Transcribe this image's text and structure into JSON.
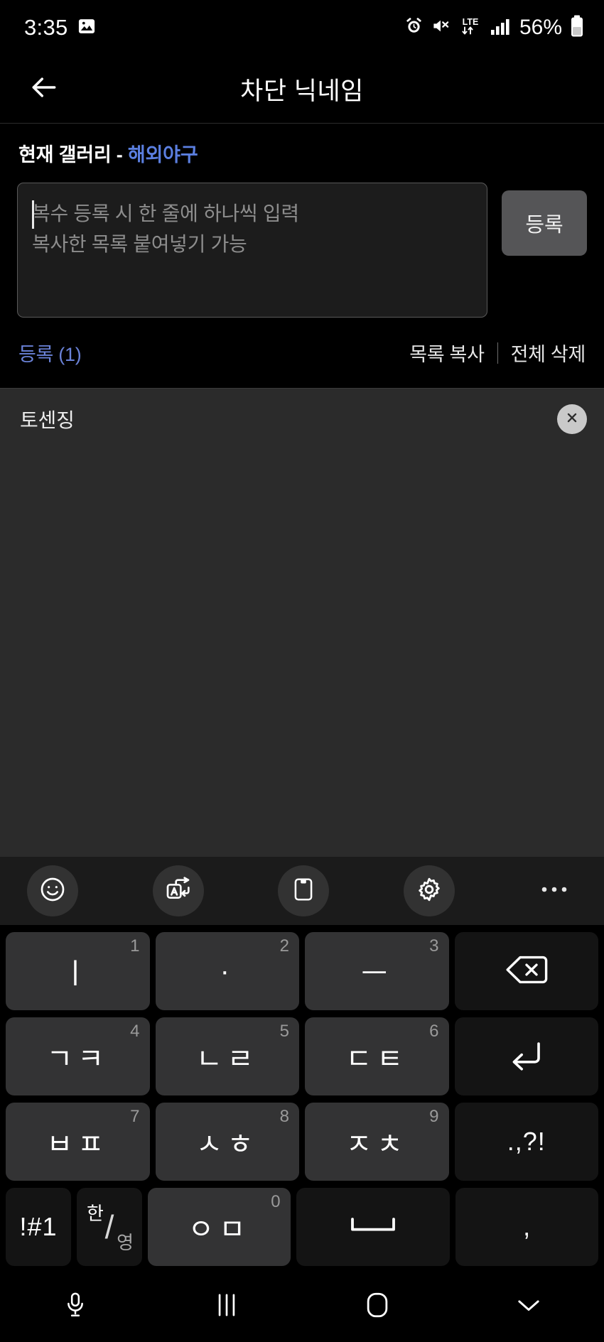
{
  "status_bar": {
    "time": "3:35",
    "battery_percent": "56%",
    "network_label": "LTE",
    "icons": [
      "gallery-image-icon",
      "alarm-icon",
      "mute-icon",
      "lte-data-icon",
      "signal-bars-icon",
      "battery-icon"
    ]
  },
  "app_bar": {
    "title": "차단 닉네임",
    "back_icon": "back-arrow-icon"
  },
  "form": {
    "gallery_prefix": "현재 갤러리 - ",
    "gallery_name": "해외야구",
    "gallery_name_color": "#5b7fe0",
    "textarea_value": "",
    "textarea_placeholder": "복수 등록 시 한 줄에 하나씩 입력\n복사한 목록 붙여넣기 가능",
    "submit_label": "등록"
  },
  "meta": {
    "count_label": "등록 (1)",
    "count_color": "#6a82d8",
    "copy_list_label": "목록 복사",
    "delete_all_label": "전체 삭제"
  },
  "blocked_list": {
    "items": [
      {
        "nickname": "토센징",
        "remove_icon": "close-circle-icon"
      }
    ]
  },
  "keyboard": {
    "toolbar": [
      {
        "name": "emoji-icon"
      },
      {
        "name": "translate-icon"
      },
      {
        "name": "clipboard-icon"
      },
      {
        "name": "settings-gear-icon"
      },
      {
        "name": "more-options-icon"
      }
    ],
    "rows": [
      [
        {
          "glyph": "ㅣ",
          "num": "1",
          "style": "normal"
        },
        {
          "glyph": "·",
          "num": "2",
          "style": "normal"
        },
        {
          "glyph": "ㅡ",
          "num": "3",
          "style": "normal"
        },
        {
          "glyph": "",
          "num": "",
          "style": "dark",
          "icon": "backspace-icon"
        }
      ],
      [
        {
          "glyph": "ㄱㅋ",
          "num": "4",
          "style": "normal"
        },
        {
          "glyph": "ㄴㄹ",
          "num": "5",
          "style": "normal"
        },
        {
          "glyph": "ㄷㅌ",
          "num": "6",
          "style": "normal"
        },
        {
          "glyph": "",
          "num": "",
          "style": "dark",
          "icon": "enter-icon"
        }
      ],
      [
        {
          "glyph": "ㅂㅍ",
          "num": "7",
          "style": "normal"
        },
        {
          "glyph": "ㅅㅎ",
          "num": "8",
          "style": "normal"
        },
        {
          "glyph": "ㅈㅊ",
          "num": "9",
          "style": "normal"
        },
        {
          "glyph": ".,?!",
          "num": "",
          "style": "dark"
        }
      ],
      [
        {
          "glyph": "!#1",
          "num": "",
          "style": "dark",
          "size": "narrow"
        },
        {
          "glyph": "한/영",
          "num": "",
          "style": "dark",
          "size": "narrow",
          "icon": "han-yeong-icon"
        },
        {
          "glyph": "ㅇㅁ",
          "num": "0",
          "style": "normal"
        },
        {
          "glyph": "",
          "num": "",
          "style": "dark",
          "icon": "space-icon"
        },
        {
          "glyph": ",",
          "num": "",
          "style": "dark"
        }
      ]
    ],
    "han_top": "한",
    "han_bottom": "영"
  },
  "nav_bar": {
    "buttons": [
      "microphone-icon",
      "recent-apps-icon",
      "home-icon",
      "hide-keyboard-icon"
    ]
  }
}
